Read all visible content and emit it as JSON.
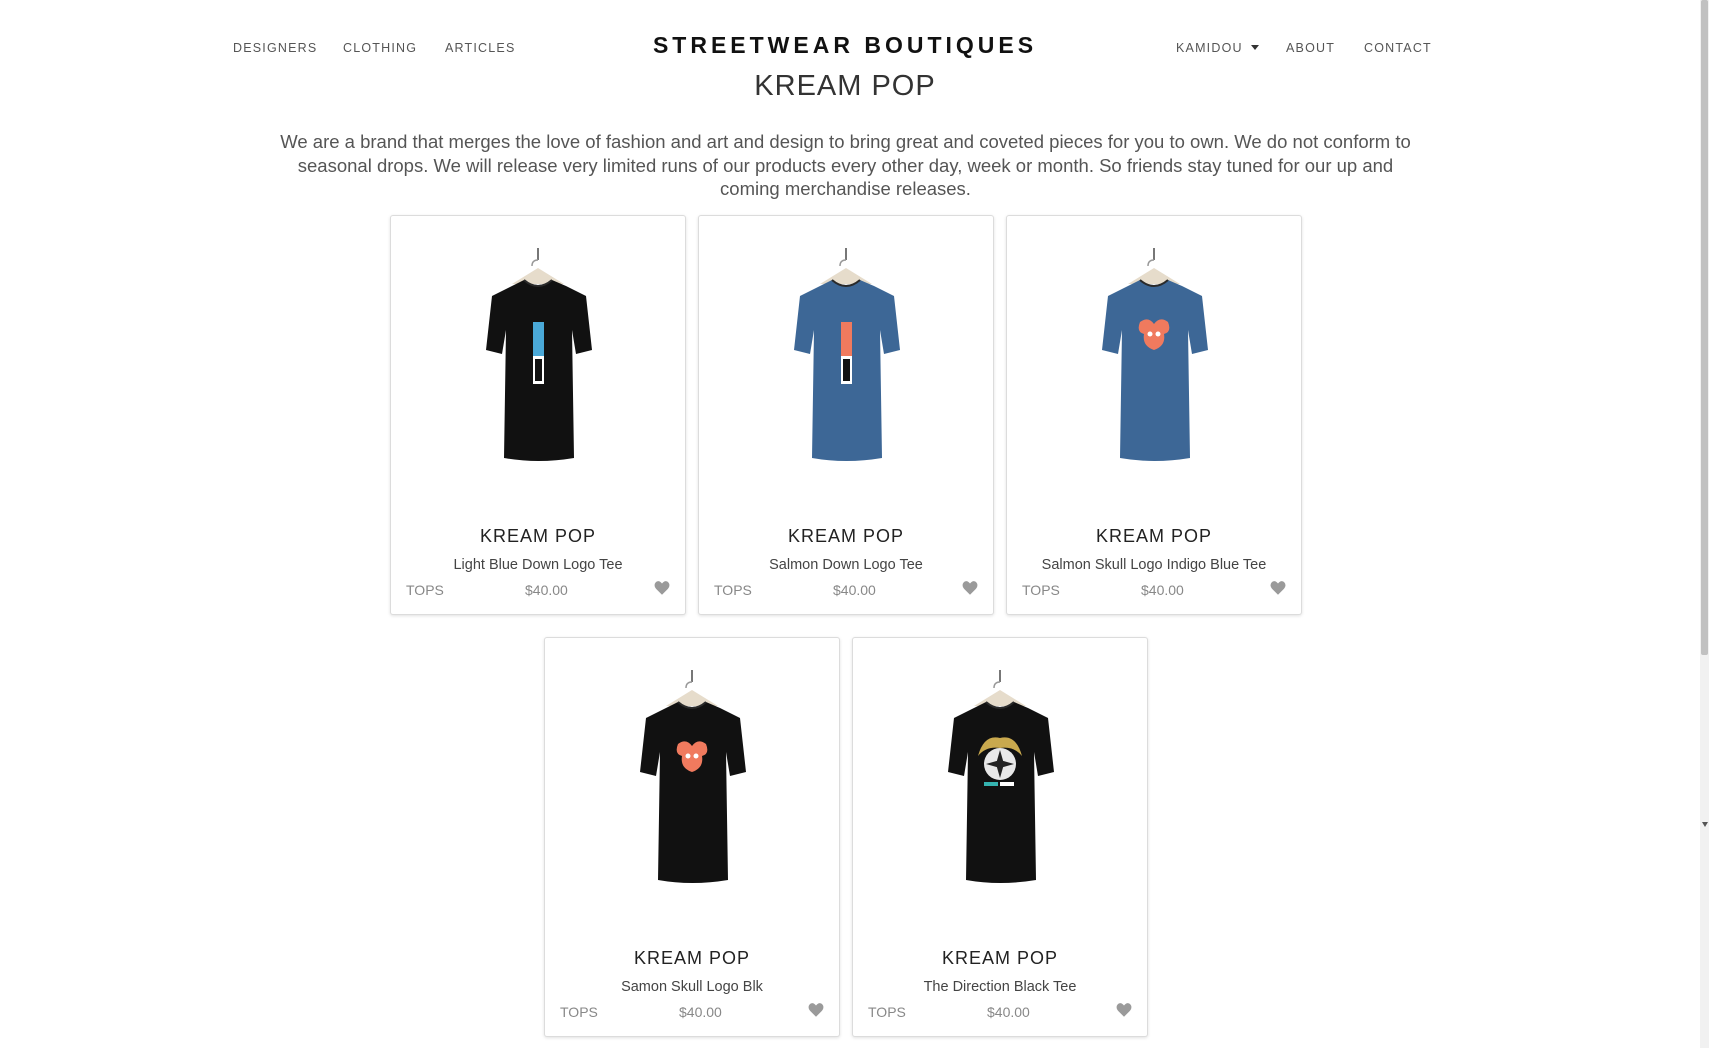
{
  "nav": {
    "left": [
      "DESIGNERS",
      "CLOTHING",
      "ARTICLES"
    ],
    "brand": "STREETWEAR BOUTIQUES",
    "user": "KAMIDOU",
    "right": [
      "ABOUT",
      "CONTACT"
    ]
  },
  "page": {
    "title": "KREAM POP",
    "description": "We are a brand that merges the love of fashion and art and design to bring great and coveted pieces for you to own. We do not conform to seasonal drops. We will release very limited runs of our products every other day, week or month. So friends stay tuned for our up and coming merchandise releases."
  },
  "products": [
    {
      "brand": "KREAM POP",
      "name": "Light Blue Down Logo Tee",
      "category": "TOPS",
      "price": "$40.00",
      "shirt_color": "#111111",
      "print": "vertical-logo-blue"
    },
    {
      "brand": "KREAM POP",
      "name": "Salmon Down Logo Tee",
      "category": "TOPS",
      "price": "$40.00",
      "shirt_color": "#3d6796",
      "print": "vertical-logo-salmon"
    },
    {
      "brand": "KREAM POP",
      "name": "Salmon Skull Logo Indigo Blue Tee",
      "category": "TOPS",
      "price": "$40.00",
      "shirt_color": "#3d6796",
      "print": "skull-salmon"
    },
    {
      "brand": "KREAM POP",
      "name": "Samon Skull Logo Blk",
      "category": "TOPS",
      "price": "$40.00",
      "shirt_color": "#111111",
      "print": "skull-salmon"
    },
    {
      "brand": "KREAM POP",
      "name": "The Direction Black Tee",
      "category": "TOPS",
      "price": "$40.00",
      "shirt_color": "#111111",
      "print": "compass-gold"
    }
  ],
  "colors": {
    "salmon": "#f07a5e",
    "light_blue": "#4aa9d8",
    "gold": "#c9a94e",
    "teal": "#35b3b0",
    "heart": "#9a9a9a"
  }
}
